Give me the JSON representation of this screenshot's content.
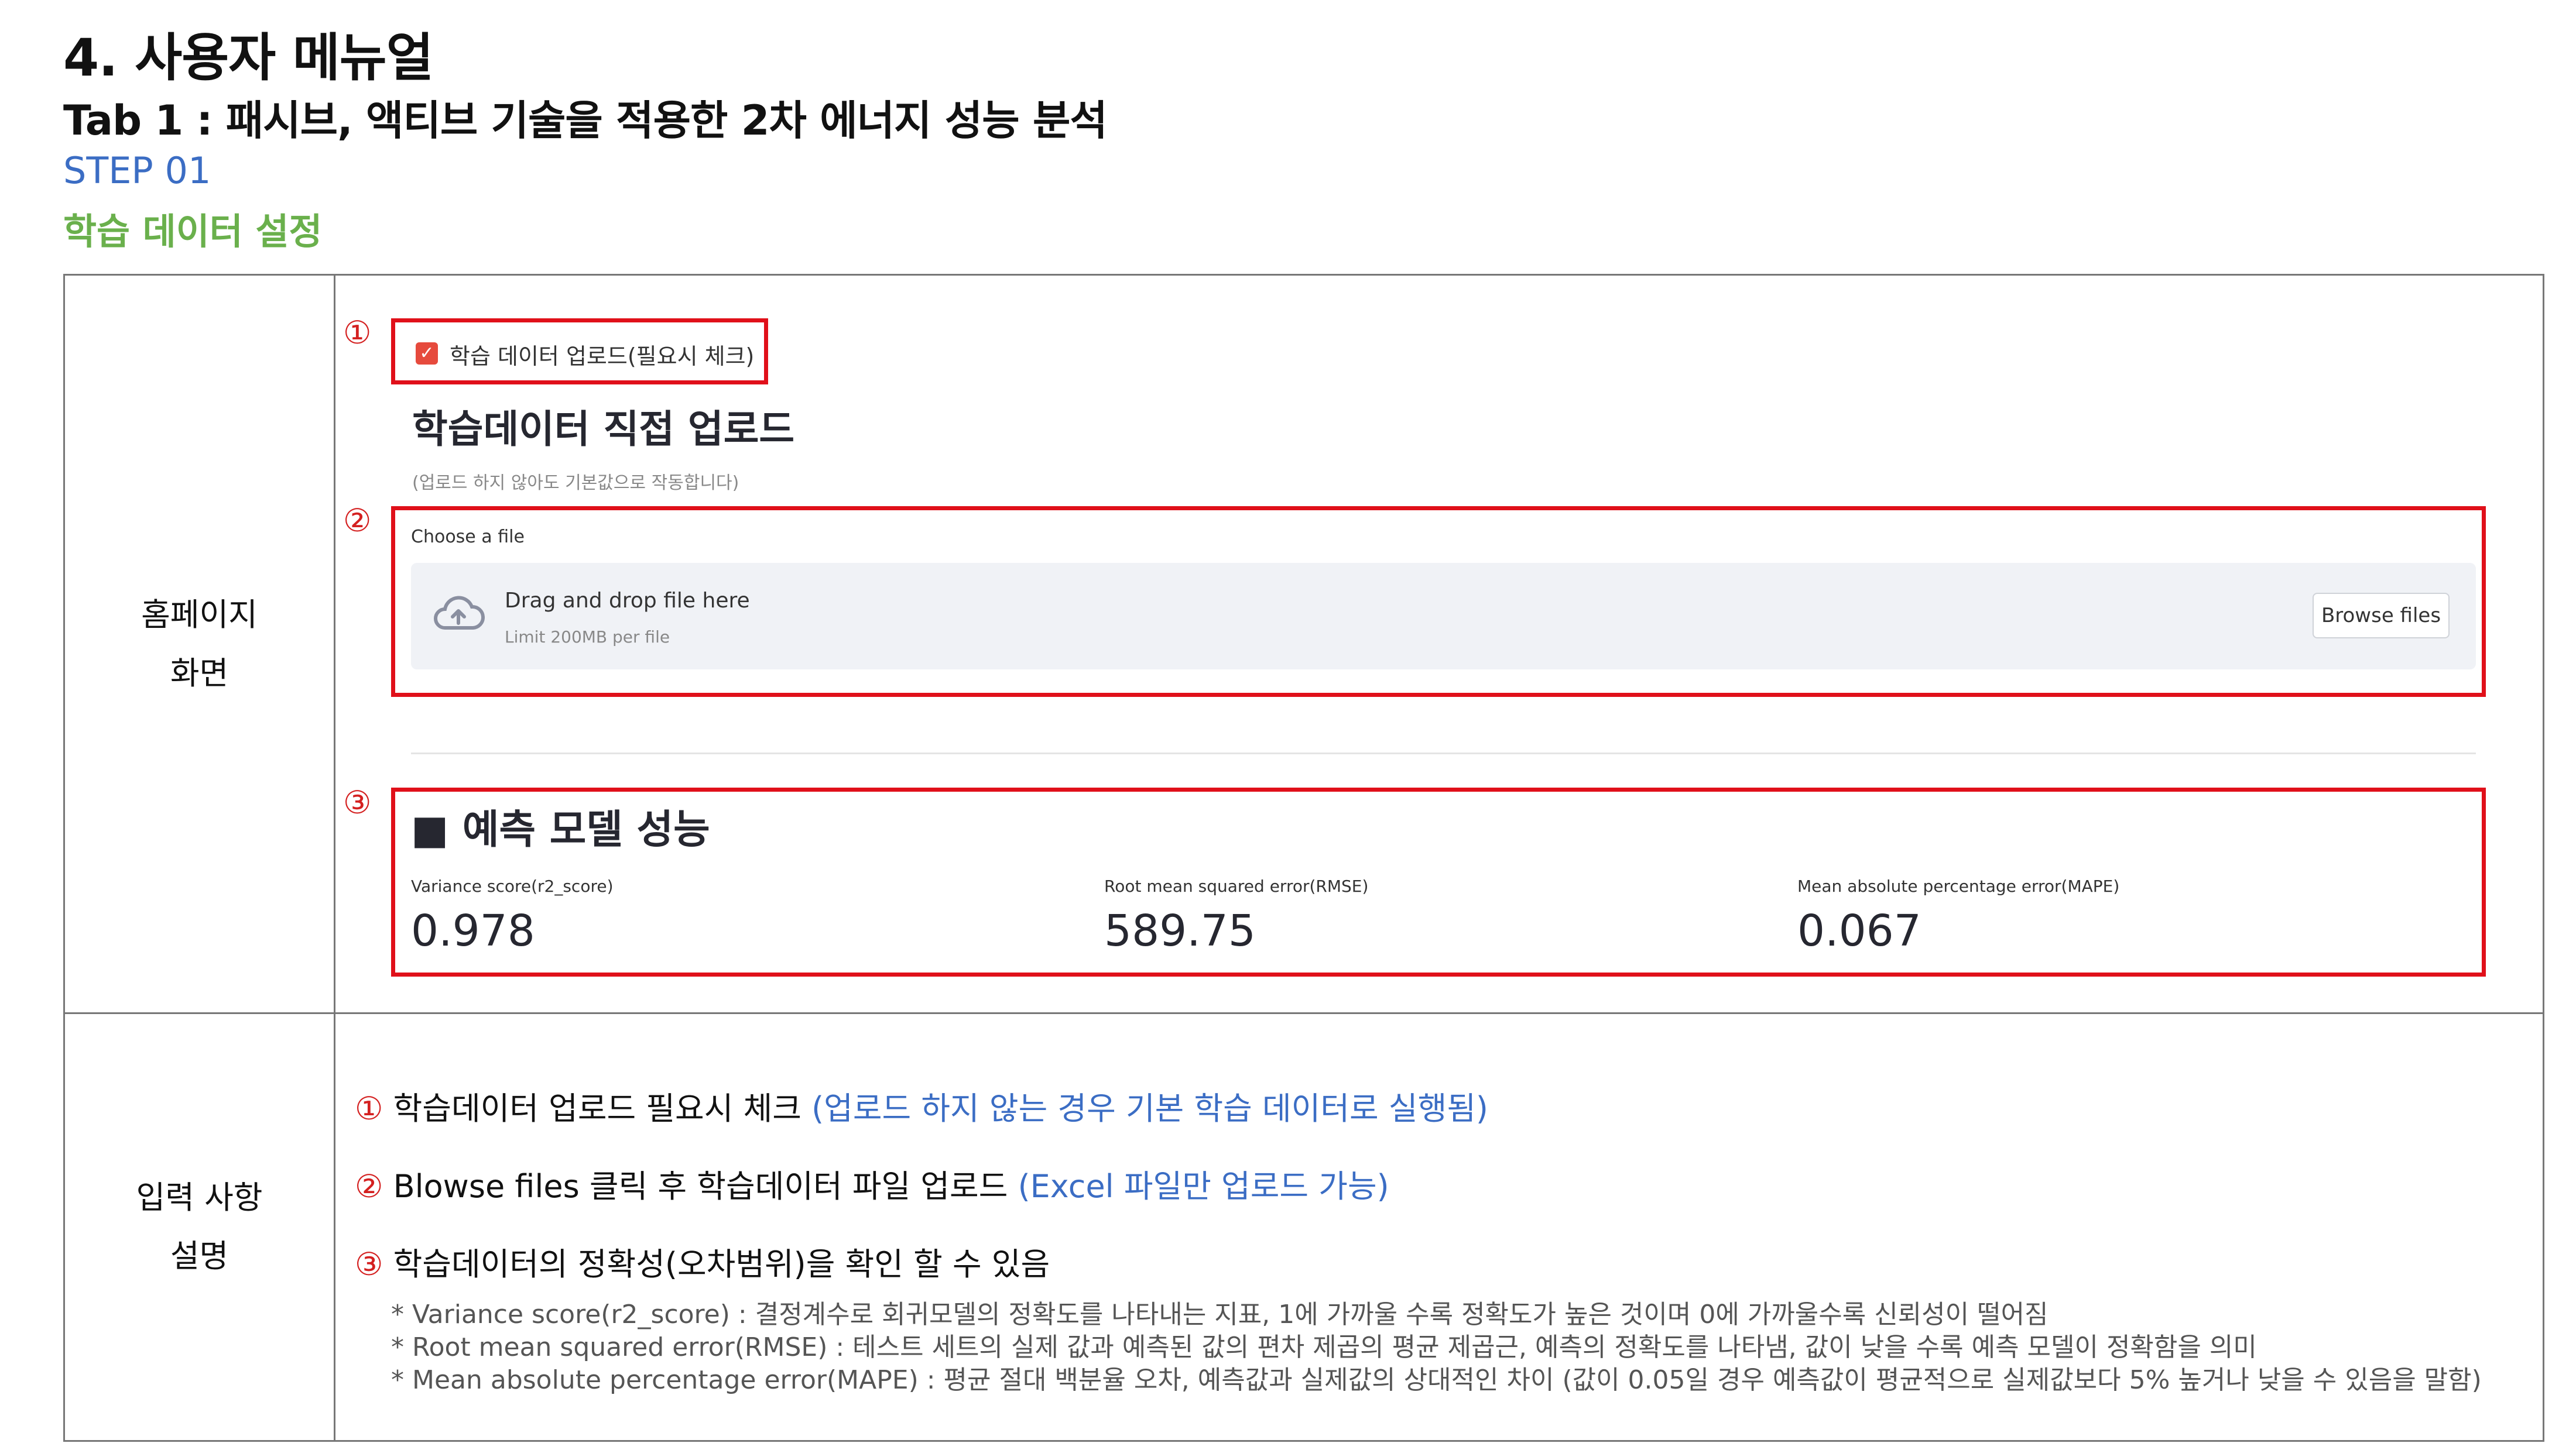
{
  "heading": {
    "title": "4. 사용자 메뉴얼",
    "tab_title": "Tab 1 : 패시브, 액티브 기술을 적용한 2차 에너지 성능 분석",
    "step": "STEP 01",
    "step_subtitle": "학습 데이터 설정"
  },
  "table": {
    "row1_label_line1": "홈페이지",
    "row1_label_line2": "화면",
    "row2_label_line1": "입력 사항",
    "row2_label_line2": "설명"
  },
  "screen": {
    "markers": [
      "①",
      "②",
      "③"
    ],
    "checkbox_label": "학습 데이터 업로드(필요시 체크)",
    "checkbox_checked": true,
    "upload_title": "학습데이터 직접 업로드",
    "upload_hint": "(업로드 하지 않아도 기본값으로 작동합니다)",
    "choose_file": "Choose a file",
    "drag_drop": "Drag and drop file here",
    "limit": "Limit 200MB per file",
    "browse_button": "Browse files",
    "perf_title": "■ 예측 모델 성능",
    "metrics": [
      {
        "label": "Variance score(r2_score)",
        "value": "0.978"
      },
      {
        "label": "Root mean squared error(RMSE)",
        "value": "589.75"
      },
      {
        "label": "Mean absolute percentage error(MAPE)",
        "value": "0.067"
      }
    ],
    "accent_red": "#e0101a",
    "check_color": "#e64a3d"
  },
  "description": {
    "items": [
      {
        "marker": "①",
        "text": "학습데이터 업로드 필요시 체크",
        "note": "(업로드 하지 않는 경우 기본 학습 데이터로 실행됨)"
      },
      {
        "marker": "②",
        "text": "Blowse files 클릭 후 학습데이터 파일 업로드",
        "note": "(Excel 파일만 업로드 가능)"
      },
      {
        "marker": "③",
        "text": "학습데이터의 정확성(오차범위)을 확인 할 수 있음",
        "note": ""
      }
    ],
    "notes": [
      "* Variance score(r2_score) : 결정계수로 회귀모델의 정확도를 나타내는 지표, 1에 가까울 수록 정확도가 높은 것이며 0에 가까울수록 신뢰성이 떨어짐",
      "* Root mean squared error(RMSE) : 테스트 세트의 실제 값과 예측된 값의 편차 제곱의 평균 제곱근, 예측의 정확도를 나타냄, 값이 낮을 수록 예측 모델이 정확함을 의미",
      "* Mean absolute percentage error(MAPE) : 평균 절대 백분율 오차, 예측값과 실제값의 상대적인 차이 (값이 0.05일 경우 예측값이 평균적으로 실제값보다 5% 높거나 낮을 수 있음을 말함)"
    ]
  }
}
